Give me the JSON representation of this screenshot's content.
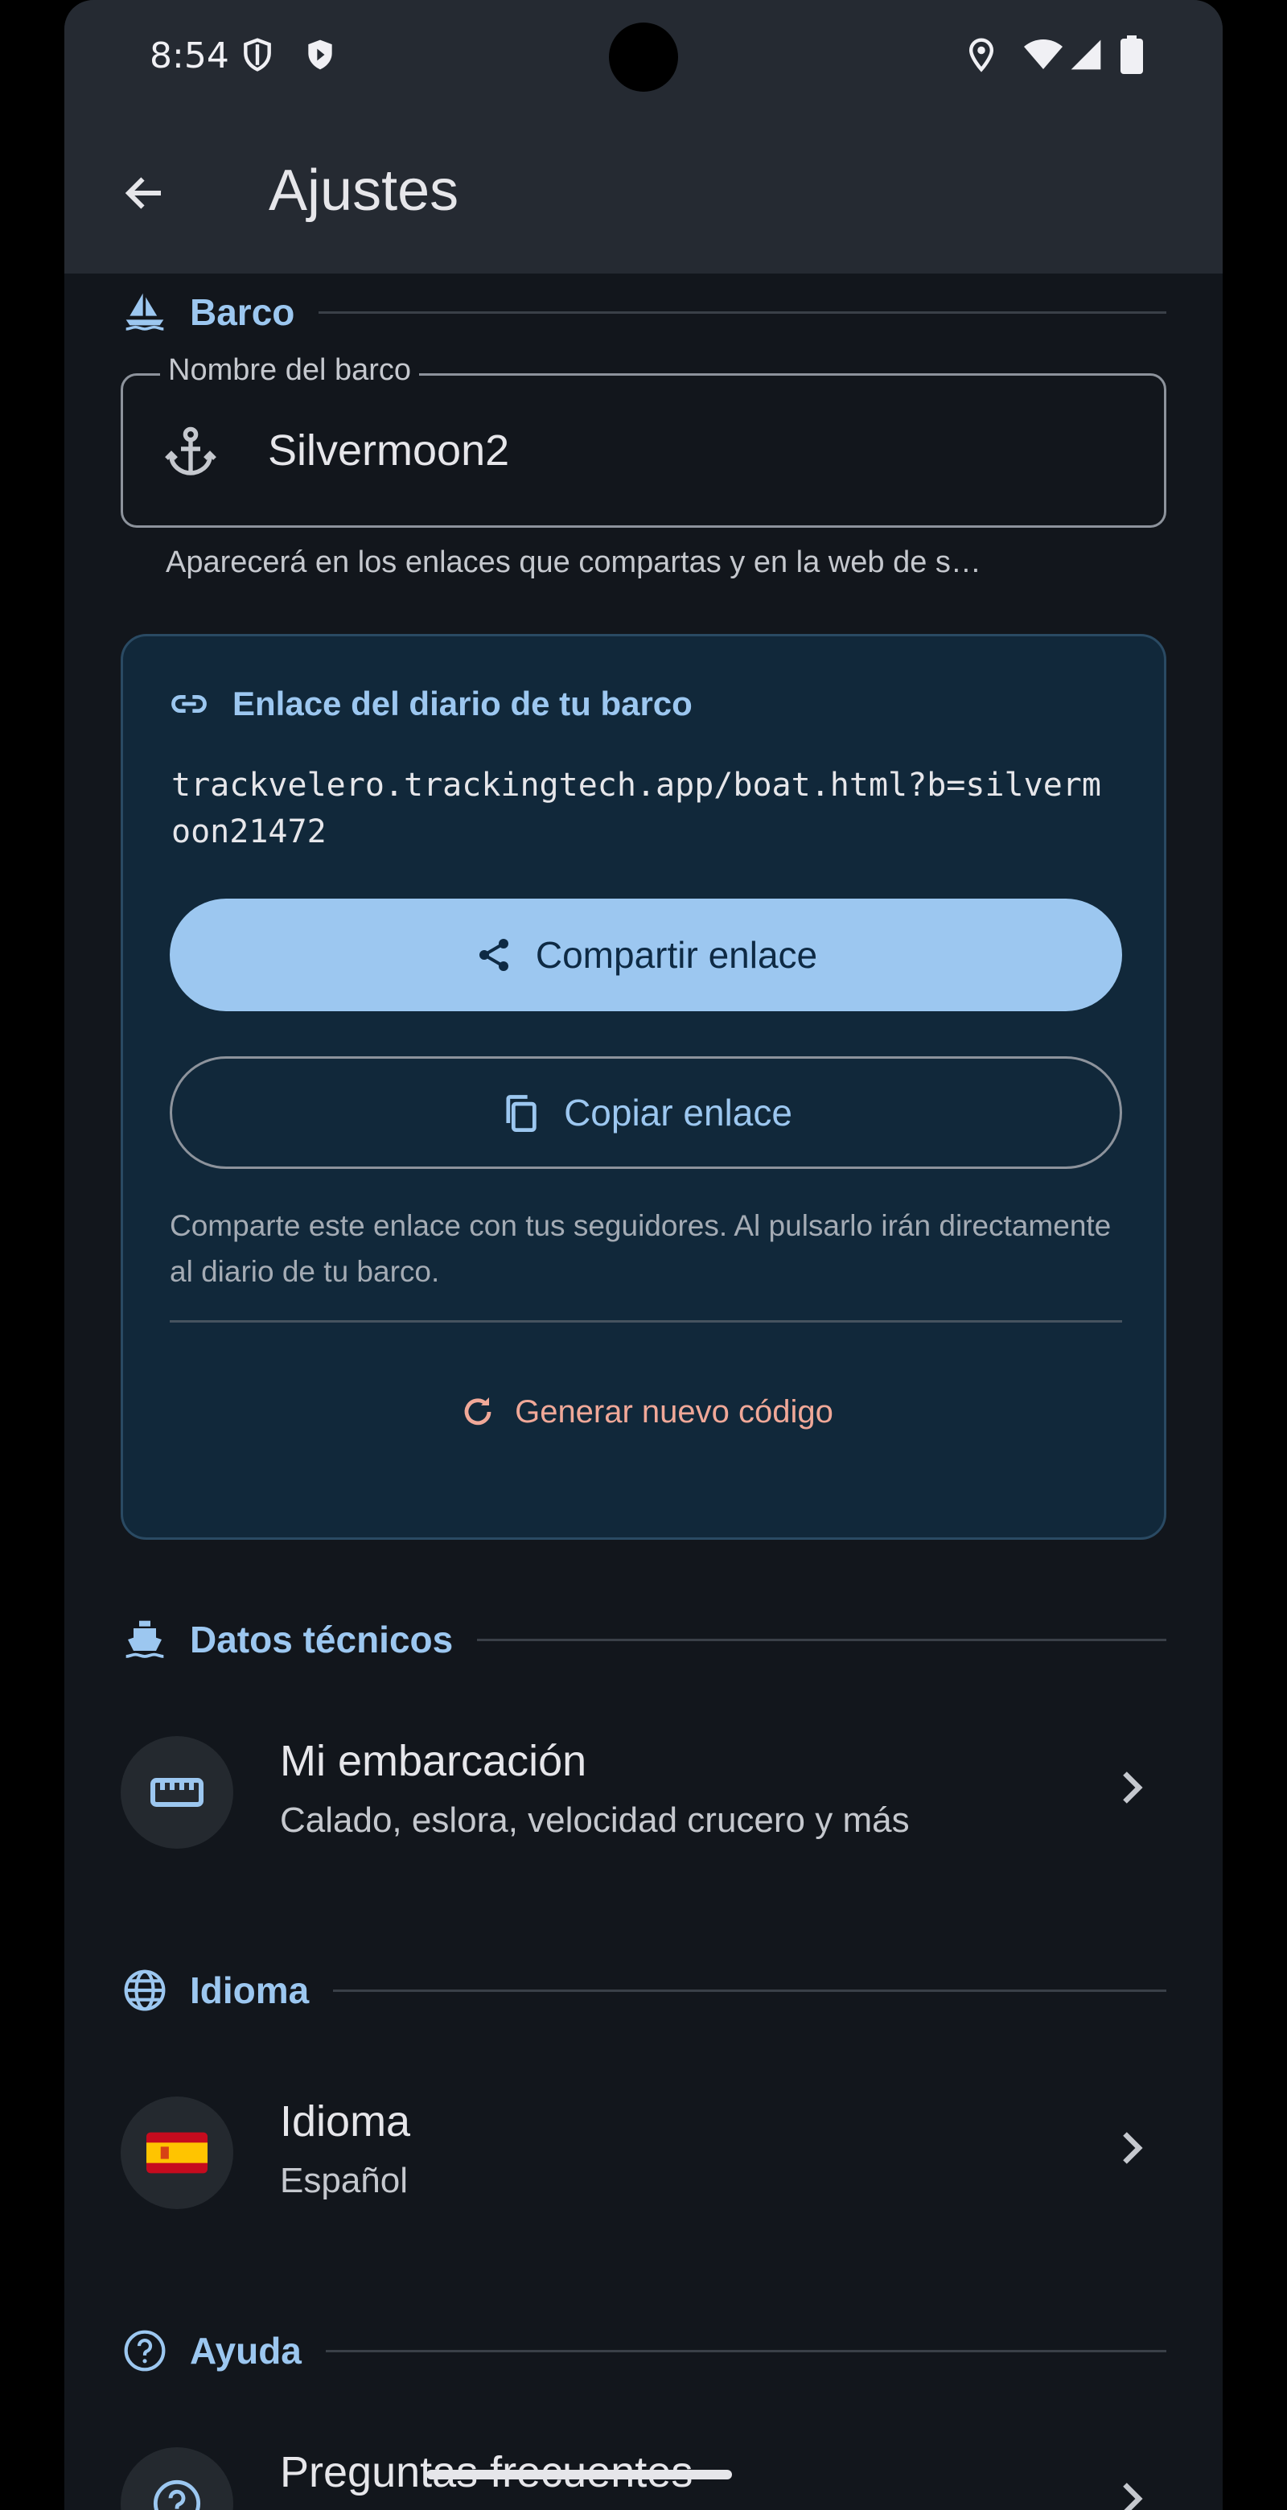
{
  "status_bar": {
    "time": "8:54"
  },
  "appbar": {
    "title": "Ajustes"
  },
  "sections": {
    "boat": {
      "label": "Barco"
    },
    "tech": {
      "label": "Datos técnicos"
    },
    "language": {
      "label": "Idioma"
    },
    "help": {
      "label": "Ayuda"
    }
  },
  "boat_name_field": {
    "label": "Nombre del barco",
    "value": "Silvermoon2",
    "helper": "Aparecerá en los enlaces que compartas y en la web de s…"
  },
  "link_card": {
    "title": "Enlace del diario de tu barco",
    "url": "trackvelero.trackingtech.app/boat.html?b=silvermoon21472",
    "share_label": "Compartir enlace",
    "copy_label": "Copiar enlace",
    "helper": "Comparte este enlace con tus seguidores. Al pulsarlo irán directamente al diario de tu barco.",
    "regen_label": "Generar nuevo código"
  },
  "tech_item": {
    "title": "Mi embarcación",
    "subtitle": "Calado, eslora, velocidad crucero y más"
  },
  "language_item": {
    "title": "Idioma",
    "subtitle": "Español",
    "flag": "🇪🇸"
  },
  "help_item": {
    "title": "Preguntas frecuentes"
  },
  "colors": {
    "accent": "#9cc7f0",
    "danger_text": "#f0a898",
    "card_bg": "#11283a",
    "bg": "#12161c"
  }
}
